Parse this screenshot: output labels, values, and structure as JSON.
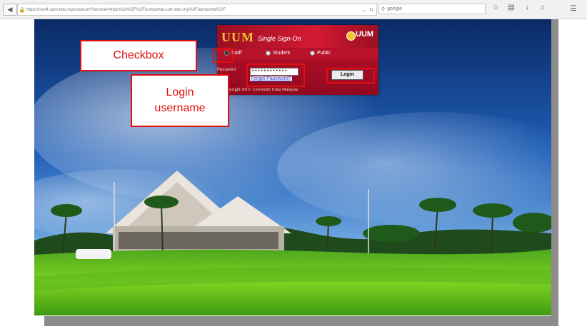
{
  "browser": {
    "back_icon": "back-arrow-icon",
    "url": "https://sso4.uum.edu.my/cas/uum?service=https%3A%2F%2Fuumportal.uum.edu.my%2Fuumportal%2F",
    "search_placeholder": "google",
    "reload_icon": "reload-icon",
    "icons": [
      "star-icon",
      "bookmarks-icon",
      "download-icon",
      "home-icon",
      "menu-icon"
    ]
  },
  "login_panel": {
    "brand": "UUM",
    "subtitle": "Single Sign-On",
    "brand_right": "UUM",
    "roles": [
      "Staff",
      "Student",
      "Public"
    ],
    "selected_role": "Staff",
    "password_label": "Password",
    "password_value": "••••••••••••",
    "forgot_link": "Forgot Password?",
    "login_button": "Login",
    "copyright": "Copyright 2013 - Universiti Utara Malaysia"
  },
  "annotations": {
    "checkbox_label": "Checkbox",
    "username_label_line1": "Login",
    "username_label_line2": "username"
  },
  "colors": {
    "panel_red": "#c8102e",
    "brand_gold": "#f4c430",
    "annotation_red": "#e01010"
  }
}
